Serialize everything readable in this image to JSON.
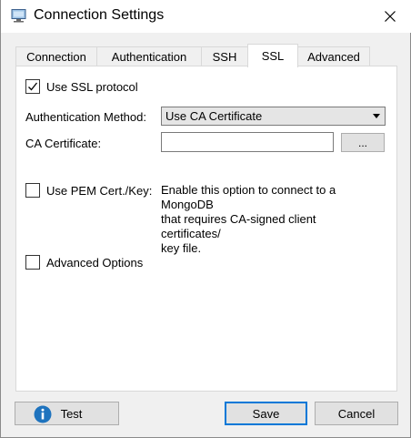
{
  "window": {
    "title": "Connection Settings",
    "icon": "computer-icon",
    "close_icon": "close-icon"
  },
  "tabs": [
    {
      "label": "Connection",
      "active": false
    },
    {
      "label": "Authentication",
      "active": false
    },
    {
      "label": "SSH",
      "active": false
    },
    {
      "label": "SSL",
      "active": true
    },
    {
      "label": "Advanced",
      "active": false
    }
  ],
  "ssl": {
    "use_ssl_label": "Use SSL protocol",
    "use_ssl_checked": true,
    "auth_method_label": "Authentication Method:",
    "auth_method_value": "Use CA Certificate",
    "ca_cert_label": "CA Certificate:",
    "ca_cert_value": "",
    "browse_label": "...",
    "use_pem_label": "Use PEM Cert./Key:",
    "use_pem_checked": false,
    "pem_description": "Enable this option to connect to a MongoDB\nthat requires CA-signed client certificates/\nkey file.",
    "advanced_options_label": "Advanced Options",
    "advanced_options_checked": false
  },
  "footer": {
    "test_label": "Test",
    "test_icon": "info-icon",
    "save_label": "Save",
    "cancel_label": "Cancel"
  },
  "colors": {
    "accent": "#0078d7",
    "panel_bg": "#ffffff",
    "window_bg": "#f0f0f0",
    "button_bg": "#e1e1e1"
  }
}
